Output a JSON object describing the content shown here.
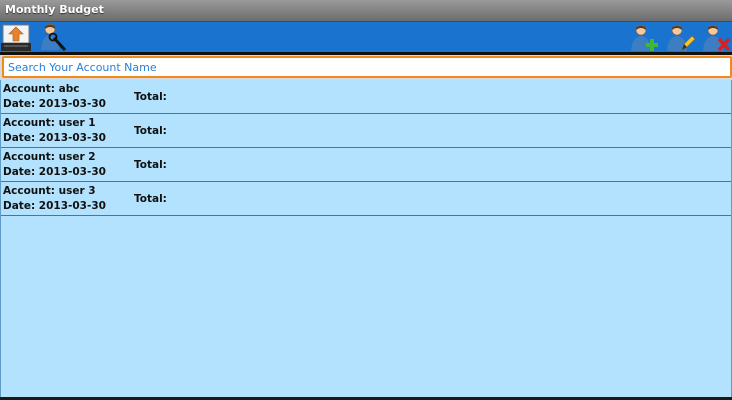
{
  "window": {
    "title": "Monthly Budget"
  },
  "toolbar": {
    "left_buttons": [
      {
        "icon": "upload-tray-icon"
      },
      {
        "icon": "search-user-icon"
      }
    ],
    "right_buttons": [
      {
        "icon": "add-user-icon"
      },
      {
        "icon": "edit-user-icon"
      },
      {
        "icon": "delete-user-icon"
      }
    ]
  },
  "search": {
    "placeholder": "Search Your Account Name",
    "value": ""
  },
  "accounts": [
    {
      "account": "Account: abc",
      "date": "Date: 2013-03-30",
      "total": "Total:"
    },
    {
      "account": "Account: user 1",
      "date": "Date: 2013-03-30",
      "total": "Total:"
    },
    {
      "account": "Account: user 2",
      "date": "Date: 2013-03-30",
      "total": "Total:"
    },
    {
      "account": "Account: user 3",
      "date": "Date: 2013-03-30",
      "total": "Total:"
    }
  ],
  "colors": {
    "toolbar": "#1a73cf",
    "list_background": "#b2e2fd",
    "search_border": "#f08a1c"
  }
}
